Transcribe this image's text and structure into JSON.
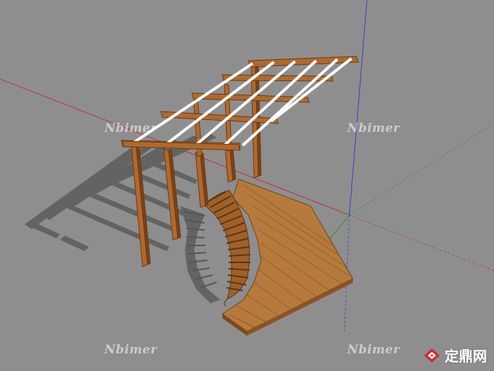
{
  "watermark": {
    "text": "Nbimer",
    "color": "#ffffff"
  },
  "brand": {
    "name": "定鼎网",
    "logo_color": "#d52a2a"
  },
  "viewport": {
    "background": "#8e8e8e",
    "axis_colors": {
      "red": "#c03434",
      "green": "#2e9a2e",
      "blue": "#3a3ad0"
    }
  },
  "model": {
    "wood_color": "#b0692c",
    "wood_dark": "#7a4218",
    "rafter_color": "#ffffff",
    "deck_color": "#b57a3c"
  }
}
